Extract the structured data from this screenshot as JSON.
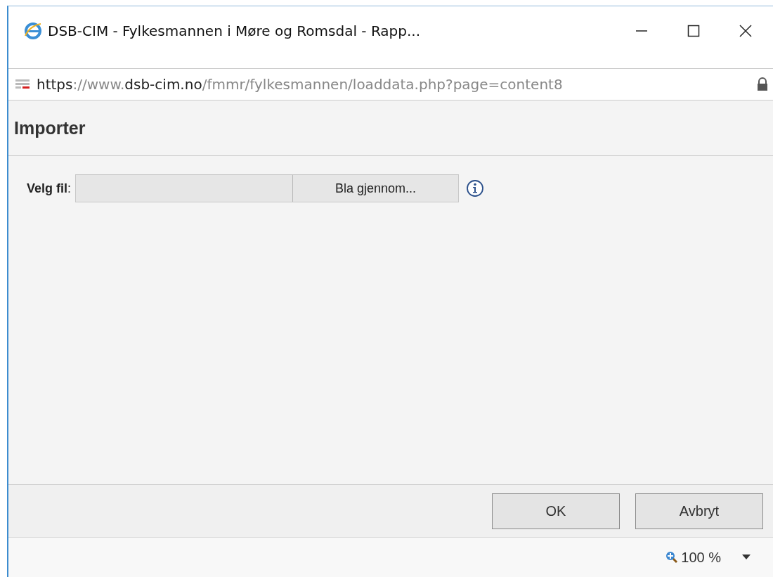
{
  "window": {
    "title": "DSB-CIM - Fylkesmannen i Møre og Romsdal - Rapp..."
  },
  "address_bar": {
    "url_parts": [
      {
        "text": "https",
        "strong": true
      },
      {
        "text": "://www.",
        "strong": false
      },
      {
        "text": "dsb-cim.no",
        "strong": true
      },
      {
        "text": "/fmmr/fylkesmannen/loaddata.php?page=content8",
        "strong": false
      }
    ],
    "secure": true
  },
  "dialog": {
    "title": "Importer",
    "file_label": "Velg fil",
    "file_label_colon": ":",
    "browse_button": "Bla gjennom...",
    "info": true
  },
  "buttons": [
    "OK",
    "Avbryt"
  ],
  "status_bar": {
    "zoom": "100 %"
  }
}
